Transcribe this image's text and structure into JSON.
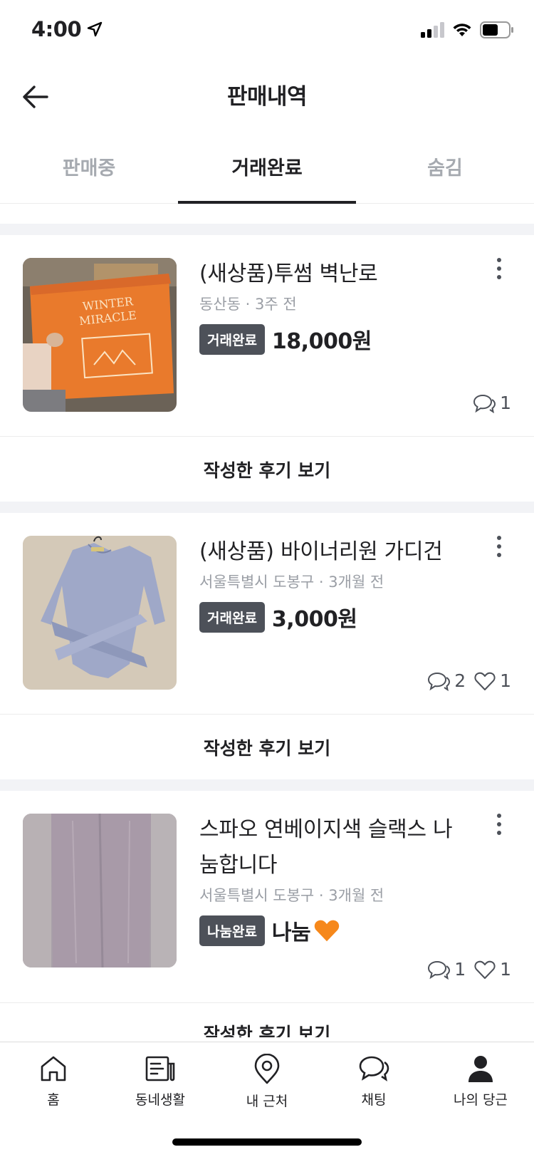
{
  "status_bar": {
    "time": "4:00"
  },
  "header": {
    "title": "판매내역"
  },
  "tabs": [
    {
      "label": "판매중",
      "active": false
    },
    {
      "label": "거래완료",
      "active": true
    },
    {
      "label": "숨김",
      "active": false
    }
  ],
  "items": [
    {
      "title": "(새상품)투썸 벽난로",
      "meta": "동산동 · 3주 전",
      "badge": "거래완료",
      "price": "18,000원",
      "chats": "1",
      "likes": null,
      "review_label": "작성한 후기 보기"
    },
    {
      "title": "(새상품) 바이너리원 가디건",
      "meta": "서울특별시 도봉구 · 3개월 전",
      "badge": "거래완료",
      "price": "3,000원",
      "chats": "2",
      "likes": "1",
      "review_label": "작성한 후기 보기"
    },
    {
      "title": "스파오 연베이지색 슬랙스 나눔합니다",
      "meta": "서울특별시 도봉구 · 3개월 전",
      "badge": "나눔완료",
      "price": "나눔",
      "chats": "1",
      "likes": "1",
      "review_label": "작성한 후기 보기"
    }
  ],
  "bottom_nav": [
    {
      "label": "홈",
      "icon": "home-icon"
    },
    {
      "label": "동네생활",
      "icon": "newspaper-icon"
    },
    {
      "label": "내 근처",
      "icon": "location-pin-icon"
    },
    {
      "label": "채팅",
      "icon": "chat-icon"
    },
    {
      "label": "나의 당근",
      "icon": "person-icon"
    }
  ],
  "colors": {
    "badge_bg": "#4d5159",
    "heart_emoji": "#f6881b"
  }
}
